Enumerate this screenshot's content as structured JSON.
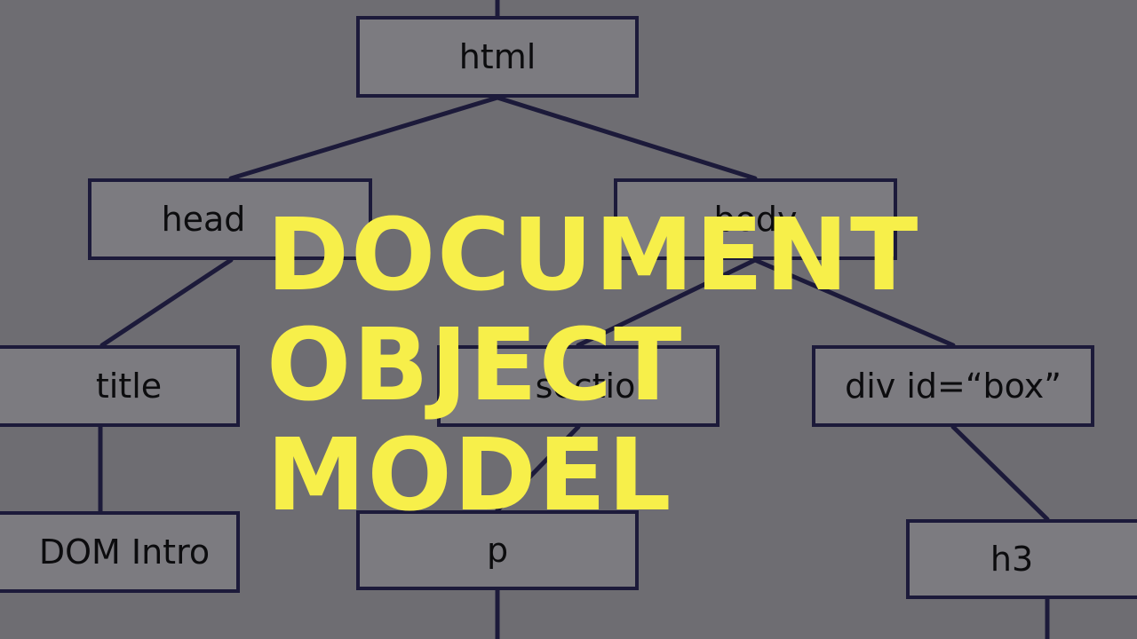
{
  "tree": {
    "nodes": {
      "html": "html",
      "head": "head",
      "body": "body",
      "title": "title",
      "section": "section",
      "div": "div id=“box”",
      "dom_intro": "DOM Intro",
      "p": "p",
      "h3": "h3"
    },
    "edge_color": "#1c1a3a",
    "node_fill": "#7c7b80"
  },
  "overlay": {
    "line1": "DOCUMENT",
    "line2": "OBJECT",
    "line3": "MODEL",
    "color": "#f7ef4a"
  }
}
